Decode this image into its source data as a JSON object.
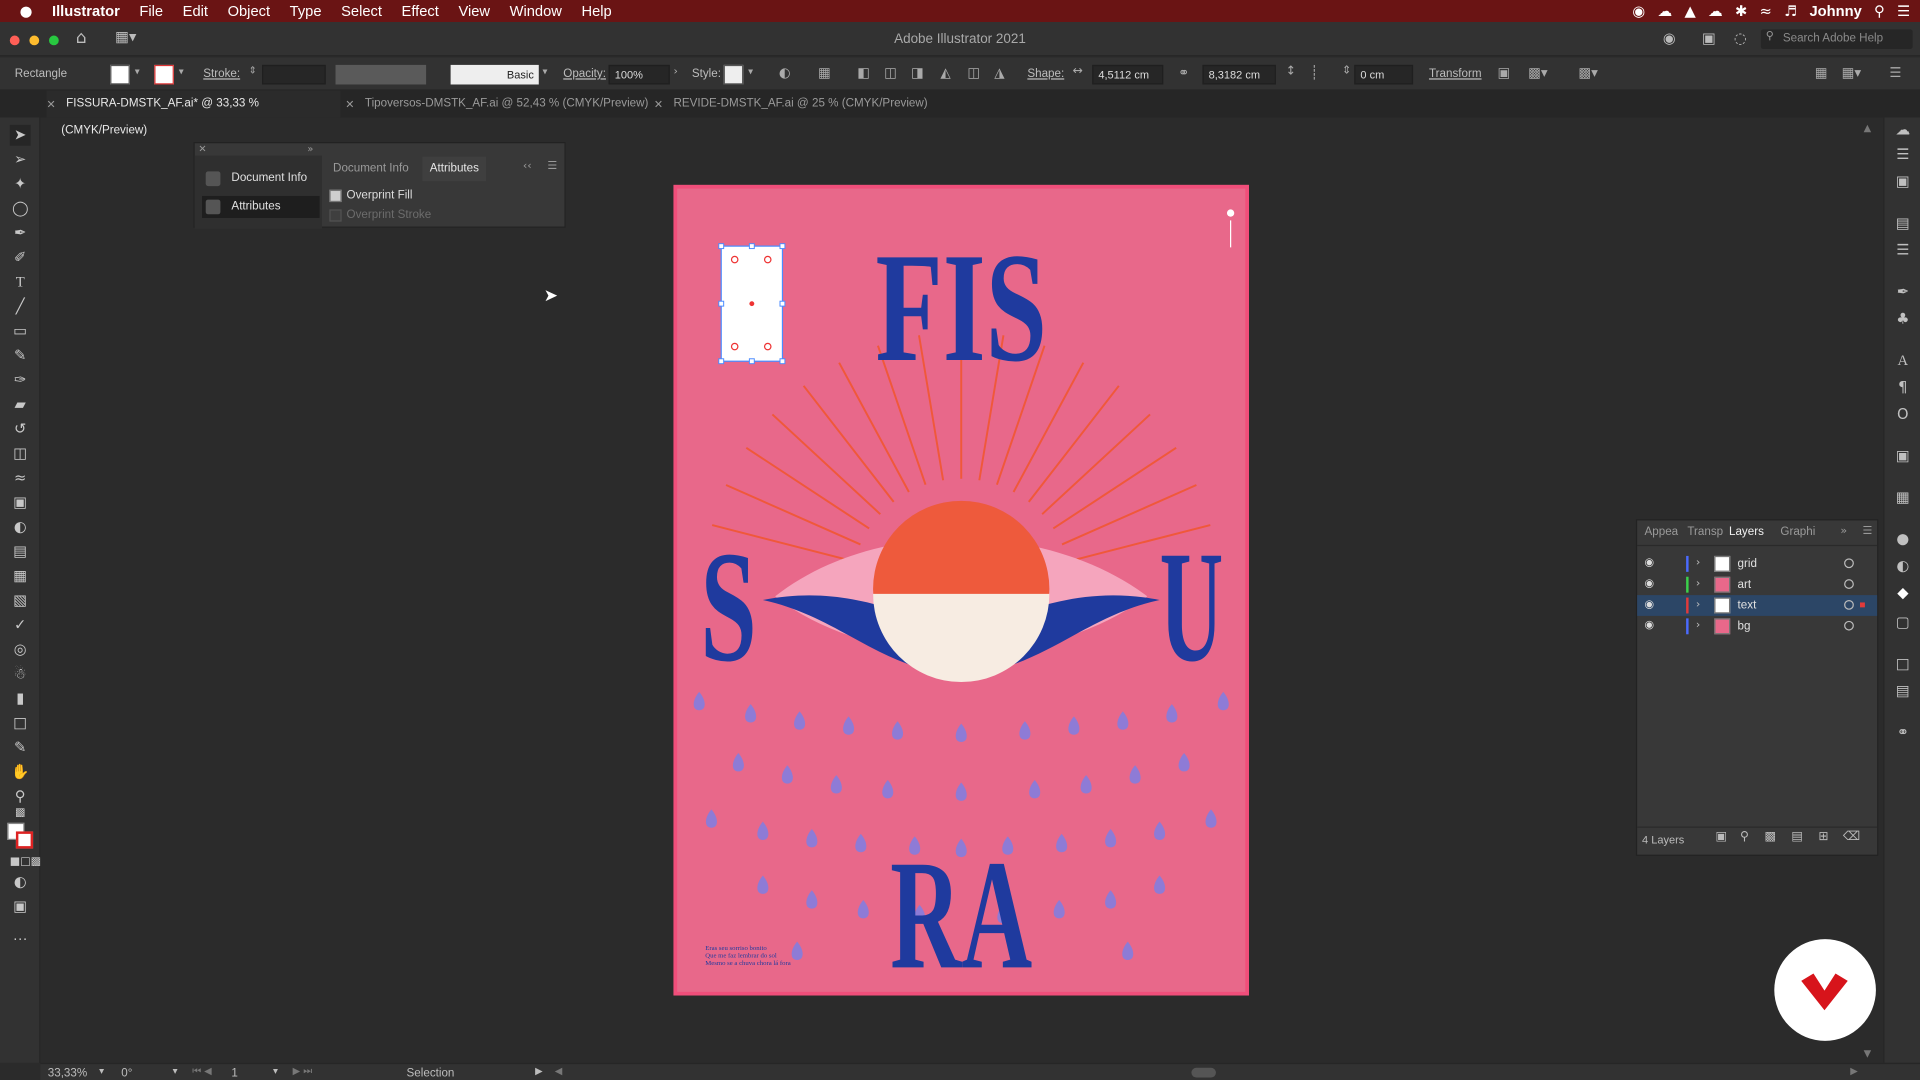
{
  "menubar": {
    "apple": "",
    "app": "Illustrator",
    "items": [
      "File",
      "Edit",
      "Object",
      "Type",
      "Select",
      "Effect",
      "View",
      "Window",
      "Help"
    ],
    "user": "Johnny"
  },
  "window": {
    "title": "Adobe Illustrator 2021",
    "search_placeholder": "Search Adobe Help"
  },
  "control_bar": {
    "object_type": "Rectangle",
    "stroke_label": "Stroke:",
    "stroke_style": "Basic",
    "opacity_label": "Opacity:",
    "opacity_value": "100%",
    "style_label": "Style:",
    "shape_label": "Shape:",
    "width_value": "4,5112 cm",
    "height_value": "8,3182 cm",
    "corner_value": "0 cm",
    "transform_label": "Transform"
  },
  "tabs": [
    {
      "label": "FISSURA-DMSTK_AF.ai* @ 33,33 % (CMYK/Preview)",
      "active": true
    },
    {
      "label": "Tipoversos-DMSTK_AF.ai @ 52,43 % (CMYK/Preview)",
      "active": false
    },
    {
      "label": "REVIDE-DMSTK_AF.ai @ 25 % (CMYK/Preview)",
      "active": false
    }
  ],
  "attributes_panel": {
    "list": [
      "Document Info",
      "Attributes"
    ],
    "tabs": [
      "Document Info",
      "Attributes"
    ],
    "overprint_fill": "Overprint Fill",
    "overprint_stroke": "Overprint Stroke"
  },
  "artwork": {
    "title_top": "FIS",
    "letter_left": "S",
    "letter_right": "U",
    "title_bottom": "RA",
    "poem": [
      "Eras seu sorriso bonito",
      "Que me faz lembrar do sol",
      "Mesmo se a chuva chora lá fora"
    ],
    "colors": {
      "bg": "#e8688a",
      "blue": "#1f3a9e",
      "sun": "#ee5a3c",
      "cream": "#f7ece2"
    }
  },
  "layers_panel": {
    "tabs": [
      "Appea",
      "Transp",
      "Layers",
      "Graphi"
    ],
    "layers": [
      {
        "name": "grid",
        "color": "#4a6bff",
        "selected": false
      },
      {
        "name": "art",
        "color": "#3bd14b",
        "selected": false
      },
      {
        "name": "text",
        "color": "#e23a3a",
        "selected": true
      },
      {
        "name": "bg",
        "color": "#4a6bff",
        "selected": false
      }
    ],
    "count": "4 Layers"
  },
  "status_bar": {
    "zoom": "33,33%",
    "rotation": "0°",
    "artboard": "1",
    "tool": "Selection"
  }
}
